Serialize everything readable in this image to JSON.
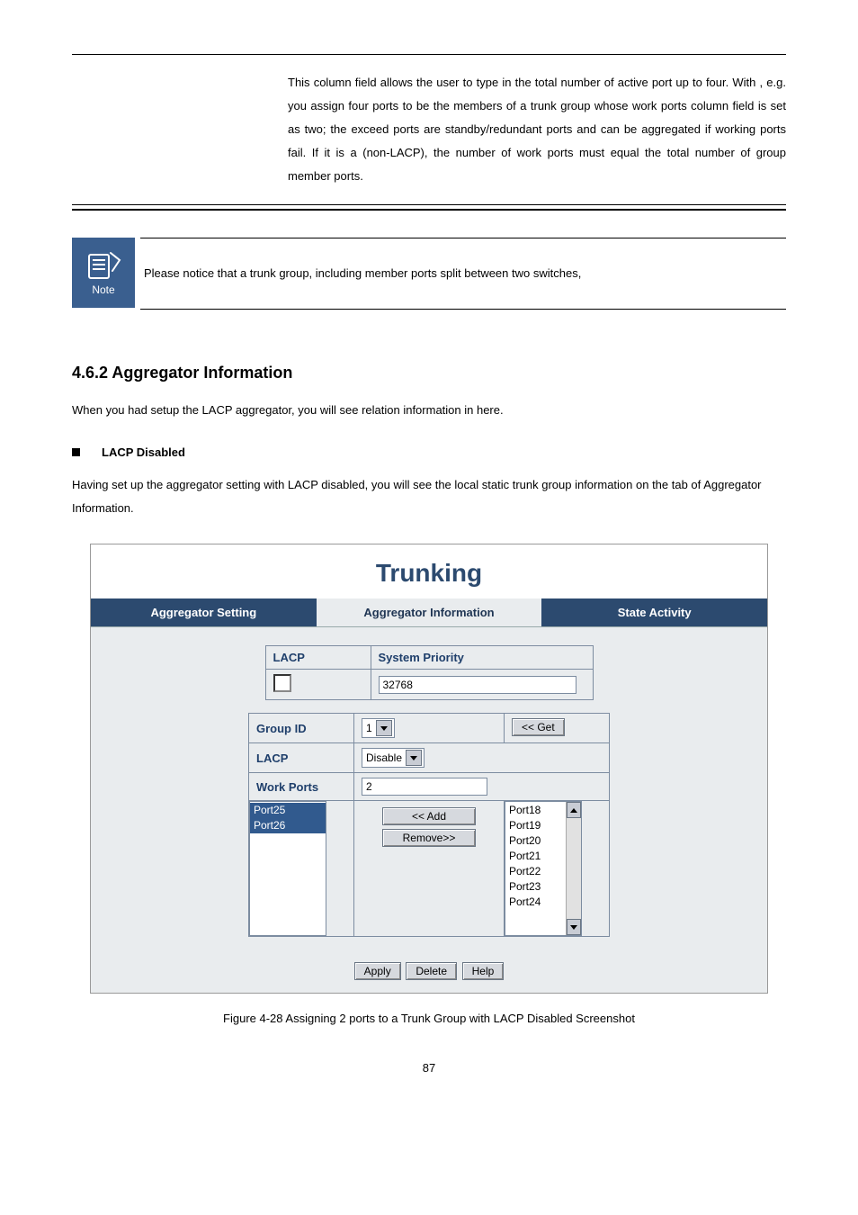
{
  "work_ports_desc": "This column field allows the user to type in the total number of active port up to four.  With",
  "work_ports_desc2": ",  e.g.  you  assign  four  ports  to  be  the members  of  a  trunk  group  whose  work  ports  column  field  is  set  as  two;  the exceed  ports  are  standby/redundant  ports  and  can  be  aggregated  if  working ports fail. If it is a",
  "work_ports_desc3": "(non-LACP), the number of work ports must equal the total number of group member ports.",
  "note_label": "Note",
  "note_text": "Please notice that a trunk group, including member ports split between two switches,",
  "section_heading": "4.6.2 Aggregator Information",
  "agg_info_para": "When you had setup the LACP aggregator, you will see relation information in here.",
  "bullet_label": "LACP Disabled",
  "static_para_a": "Having set up the aggregator setting with LACP disabled, you will see the local static trunk group information on the tab of",
  "static_para_b": "Aggregator Information",
  "fig": {
    "title": "Trunking",
    "tabs": {
      "setting": "Aggregator Setting",
      "info": "Aggregator Information",
      "activity": "State Activity"
    },
    "lacp_label": "LACP",
    "sys_priority_label": "System Priority",
    "sys_priority_value": "32768",
    "group_id_label": "Group ID",
    "group_id_value": "1",
    "get_btn": "<< Get",
    "lacp_row_label": "LACP",
    "lacp_select": "Disable",
    "work_ports_label": "Work Ports",
    "work_ports_value": "2",
    "left_ports": [
      "Port25",
      "Port26"
    ],
    "right_ports": [
      "Port18",
      "Port19",
      "Port20",
      "Port21",
      "Port22",
      "Port23",
      "Port24"
    ],
    "add_btn": "<< Add",
    "remove_btn": "Remove>>",
    "apply_btn": "Apply",
    "delete_btn": "Delete",
    "help_btn": "Help"
  },
  "fig_caption_prefix": "Figure 4-28",
  "fig_caption": "Assigning 2 ports to a Trunk Group with LACP Disabled Screenshot",
  "page_number": "87"
}
